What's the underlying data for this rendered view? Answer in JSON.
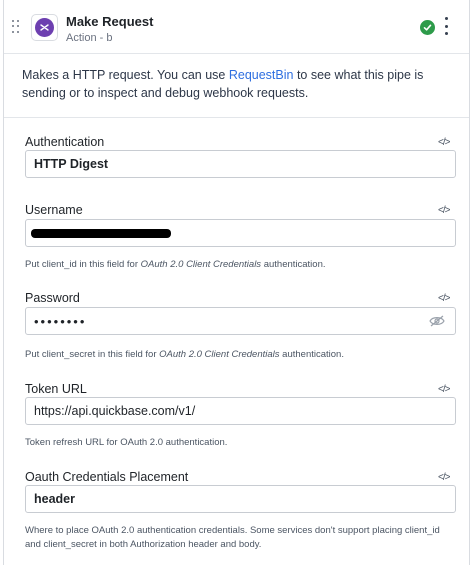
{
  "header": {
    "title": "Make Request",
    "subtitle": "Action - b"
  },
  "description": {
    "before_link": "Makes a HTTP request.  You can use ",
    "link": "RequestBin",
    "after_link": " to see what this pipe is sending or to inspect and debug webhook requests."
  },
  "code_toggle": "</>",
  "fields": {
    "authentication": {
      "label": "Authentication",
      "value": "HTTP Digest"
    },
    "username": {
      "label": "Username",
      "value": "",
      "help_before": "Put client_id in this field for ",
      "help_em": "OAuth 2.0 Client Credentials",
      "help_after": " authentication."
    },
    "password": {
      "label": "Password",
      "value": "••••••••",
      "help_before": "Put client_secret in this field for ",
      "help_em": "OAuth 2.0 Client Credentials",
      "help_after": " authentication."
    },
    "token_url": {
      "label": "Token URL",
      "value": "https://api.quickbase.com/v1/",
      "help": "Token refresh URL for OAuth 2.0 authentication."
    },
    "oauth_placement": {
      "label": "Oauth Credentials Placement",
      "value": "header",
      "help": "Where to place OAuth 2.0 authentication credentials. Some services don't support placing client_id and client_secret in both Authorization header and body."
    }
  },
  "icons": {
    "drag": "drag-handle-icon",
    "app": "webhook-app-icon",
    "status": "check-circle-icon",
    "more": "more-vertical-icon",
    "code": "code-icon",
    "visibility": "eye-off-icon"
  },
  "colors": {
    "link": "#2f6fe0",
    "status_ok": "#2e9b4a",
    "app_icon": "#6d3fb0"
  }
}
